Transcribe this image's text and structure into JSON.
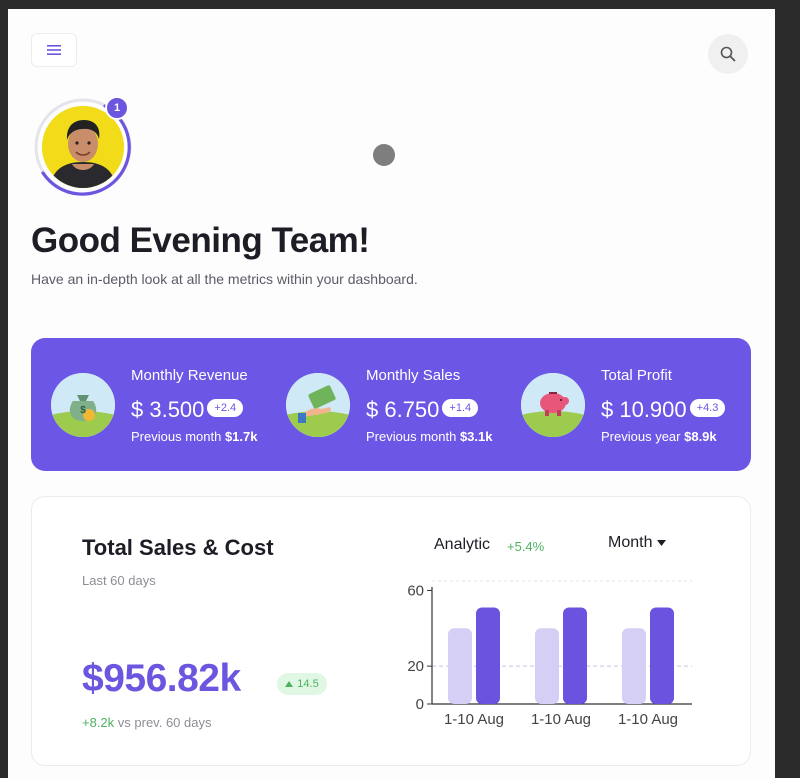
{
  "header": {
    "menu_icon": "hamburger-menu-icon",
    "search_icon": "search-icon",
    "notification_count": "1"
  },
  "greeting": {
    "title": "Good Evening Team!",
    "subtitle": "Have an in-depth look at all the metrics within your dashboard."
  },
  "stats": [
    {
      "title": "Monthly Revenue",
      "value": "$ 3.500",
      "badge": "+2.4",
      "prev_label": "Previous month",
      "prev_value": "$1.7k",
      "icon": "money-bag-icon"
    },
    {
      "title": "Monthly Sales",
      "value": "$ 6.750",
      "badge": "+1.4",
      "prev_label": "Previous month",
      "prev_value": "$3.1k",
      "icon": "hand-cash-icon"
    },
    {
      "title": "Total Profit",
      "value": "$ 10.900",
      "badge": "+4.3",
      "prev_label": "Previous year",
      "prev_value": "$8.9k",
      "icon": "piggy-bank-icon"
    }
  ],
  "sales": {
    "title": "Total Sales & Cost",
    "range": "Last 60 days",
    "total": "$956.82k",
    "pill": "14.5",
    "diff_positive": "+8.2k",
    "diff_rest": " vs prev. 60 days",
    "analytic_label": "Analytic",
    "analytic_change": "+5.4%",
    "period": "Month"
  },
  "colors": {
    "accent": "#6c56e6",
    "bar_light": "#d5cff5",
    "bar_dark": "#6b52df",
    "positive": "#4fb261"
  },
  "chart_data": {
    "type": "bar",
    "categories": [
      "1-10 Aug",
      "1-10 Aug",
      "1-10 Aug"
    ],
    "series": [
      {
        "values": [
          40,
          40,
          40
        ]
      },
      {
        "values": [
          51,
          51,
          51
        ]
      }
    ],
    "y_ticks": [
      0,
      20,
      60
    ],
    "ylim": [
      0,
      65
    ],
    "grid": "dashed line at 20"
  }
}
